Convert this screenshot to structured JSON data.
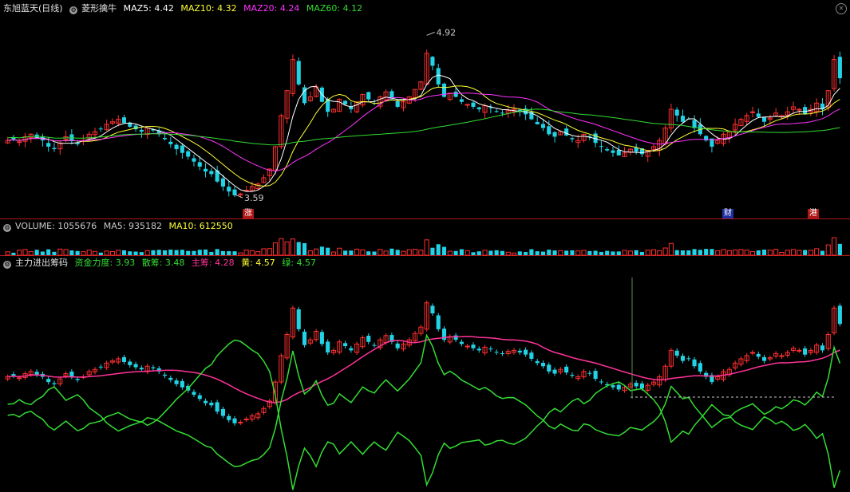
{
  "header": {
    "stock_name": "东旭蓝天(日线)",
    "indicator_name": "菱形擒牛",
    "ma_items": [
      {
        "label": "MAZ5: 4.42",
        "color": "#ffffff"
      },
      {
        "label": "MAZ10: 4.32",
        "color": "#ffff33"
      },
      {
        "label": "MAZ20: 4.24",
        "color": "#ff33ff"
      },
      {
        "label": "MAZ60: 4.12",
        "color": "#33dd33"
      }
    ]
  },
  "price_panel": {
    "high_label": "4.92",
    "low_label": "3.59",
    "markers": [
      "涨",
      "财",
      "港"
    ]
  },
  "volume_panel": {
    "items": [
      {
        "label": "VOLUME: 1055676",
        "color": "#c8c8c8"
      },
      {
        "label": "MA5: 935182",
        "color": "#c8c8c8"
      },
      {
        "label": "MA10: 612550",
        "color": "#ffff33"
      }
    ]
  },
  "fund_panel": {
    "title": "主力进出筹码",
    "items": [
      {
        "label": "资金力度: 3.93",
        "color": "#33dd33"
      },
      {
        "label": "散筹: 3.48",
        "color": "#33dd33"
      },
      {
        "label": "主筹: 4.28",
        "color": "#ff3399"
      },
      {
        "label": "黄: 4.57",
        "color": "#ffff33"
      },
      {
        "label": "绿: 4.57",
        "color": "#33dd33"
      }
    ]
  },
  "colors": {
    "up": "#ff3030",
    "down": "#22d3e6",
    "grid": "#b01818"
  },
  "chart_data": {
    "type": "candlestick",
    "title": "东旭蓝天(日线)",
    "price_range": [
      3.5,
      5.05
    ],
    "high": 4.92,
    "low": 3.59,
    "moving_averages": {
      "MAZ5": 4.42,
      "MAZ10": 4.32,
      "MAZ20": 4.24,
      "MAZ60": 4.12
    },
    "volume": {
      "VOLUME": 1055676,
      "MA5": 935182,
      "MA10": 612550
    },
    "fund_flow": {
      "资金力度": 3.93,
      "散筹": 3.48,
      "主筹": 4.28,
      "黄": 4.57,
      "绿": 4.57
    },
    "closes": [
      4.05,
      4.06,
      4.04,
      4.08,
      4.1,
      4.07,
      4.05,
      4.0,
      3.98,
      4.03,
      4.08,
      4.05,
      4.02,
      4.05,
      4.1,
      4.12,
      4.14,
      4.18,
      4.2,
      4.22,
      4.19,
      4.16,
      4.14,
      4.12,
      4.15,
      4.13,
      4.1,
      4.06,
      4.02,
      3.98,
      3.95,
      3.92,
      3.88,
      3.84,
      3.8,
      3.78,
      3.72,
      3.68,
      3.64,
      3.61,
      3.62,
      3.65,
      3.68,
      3.7,
      3.75,
      3.82,
      4.0,
      4.25,
      4.45,
      4.7,
      4.5,
      4.35,
      4.4,
      4.48,
      4.36,
      4.28,
      4.3,
      4.38,
      4.34,
      4.3,
      4.36,
      4.42,
      4.38,
      4.35,
      4.4,
      4.44,
      4.38,
      4.32,
      4.36,
      4.4,
      4.46,
      4.52,
      4.75,
      4.65,
      4.5,
      4.4,
      4.43,
      4.4,
      4.36,
      4.34,
      4.32,
      4.3,
      4.33,
      4.31,
      4.28,
      4.27,
      4.29,
      4.3,
      4.28,
      4.26,
      4.22,
      4.18,
      4.15,
      4.1,
      4.08,
      4.12,
      4.09,
      4.06,
      4.05,
      4.1,
      4.08,
      4.03,
      4.0,
      3.97,
      3.95,
      3.93,
      3.95,
      3.98,
      3.96,
      3.94,
      3.97,
      4.0,
      4.05,
      4.15,
      4.3,
      4.25,
      4.2,
      4.22,
      4.15,
      4.1,
      4.05,
      4.0,
      4.05,
      4.1,
      4.12,
      4.18,
      4.22,
      4.25,
      4.28,
      4.24,
      4.2,
      4.23,
      4.27,
      4.25,
      4.28,
      4.32,
      4.3,
      4.26,
      4.3,
      4.35,
      4.3,
      4.45,
      4.7,
      4.55
    ]
  }
}
